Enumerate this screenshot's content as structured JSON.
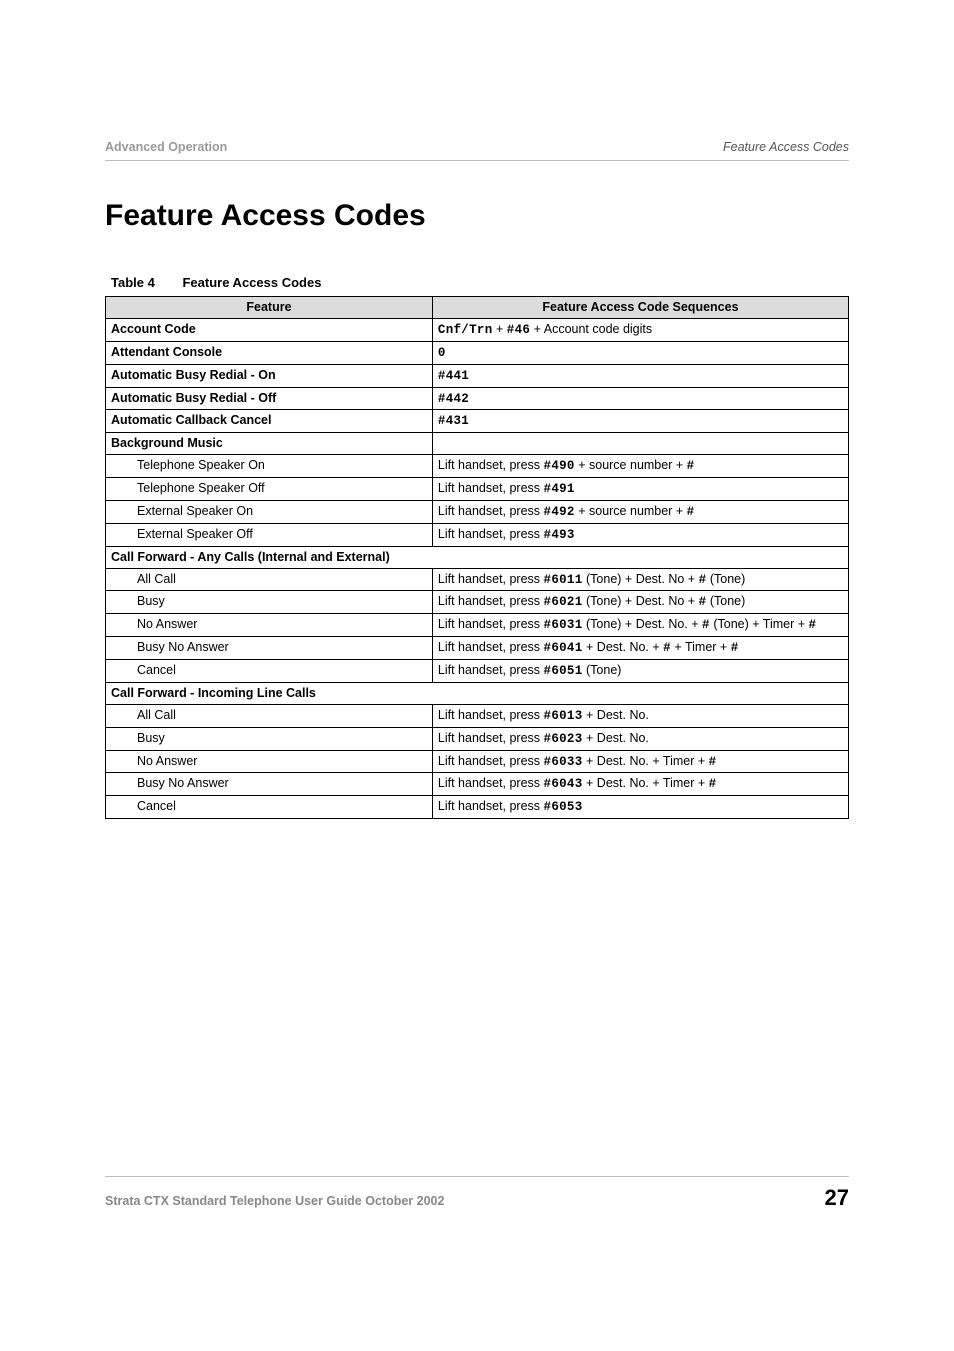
{
  "header": {
    "left": "Advanced Operation",
    "right": "Feature Access Codes"
  },
  "title": "Feature Access Codes",
  "table": {
    "number": "Table 4",
    "caption": "Feature Access Codes",
    "head_feature": "Feature",
    "head_seq": "Feature Access Code Sequences"
  },
  "rows": {
    "account_code_label": "Account Code",
    "account_code_seq_pre": "Cnf/Trn",
    "account_code_seq_plus1": " + ",
    "account_code_seq_code": "#46",
    "account_code_seq_rest": " + Account code digits",
    "attendant_label": "Attendant Console",
    "attendant_seq": "0",
    "abr_on_label": "Automatic Busy Redial - On",
    "abr_on_seq": "#441",
    "abr_off_label": "Automatic Busy Redial - Off",
    "abr_off_seq": "#442",
    "acc_label": "Automatic Callback Cancel",
    "acc_seq": "#431",
    "bg_music_label": "Background Music",
    "tel_spk_on_label": "Telephone Speaker On",
    "tel_spk_on_pre": "Lift handset, press ",
    "tel_spk_on_code": "#490",
    "tel_spk_on_mid": " + source number + ",
    "tel_spk_on_end": "#",
    "tel_spk_off_label": "Telephone Speaker Off",
    "tel_spk_off_pre": "Lift handset, press ",
    "tel_spk_off_code": "#491",
    "ext_spk_on_label": "External Speaker On",
    "ext_spk_on_pre": "Lift handset, press ",
    "ext_spk_on_code": "#492",
    "ext_spk_on_mid": " + source number + ",
    "ext_spk_on_end": "#",
    "ext_spk_off_label": "External Speaker Off",
    "ext_spk_off_pre": "Lift handset, press ",
    "ext_spk_off_code": "#493",
    "cf_any_label": "Call Forward - Any Calls (Internal and External)",
    "cf_any_all_label": "All Call",
    "cf_any_all_pre": "Lift handset, press ",
    "cf_any_all_code": "#6011",
    "cf_any_all_mid": " (Tone) + Dest. No + ",
    "cf_any_all_end": "#",
    "cf_any_all_tail": " (Tone)",
    "cf_any_busy_label": "Busy",
    "cf_any_busy_pre": "Lift handset, press ",
    "cf_any_busy_code": "#6021",
    "cf_any_busy_mid": " (Tone) + Dest. No + ",
    "cf_any_busy_end": "#",
    "cf_any_busy_tail": " (Tone)",
    "cf_any_na_label": "No Answer",
    "cf_any_na_pre": "Lift handset, press ",
    "cf_any_na_code": "#6031",
    "cf_any_na_mid": " (Tone) + Dest. No. + ",
    "cf_any_na_end": "#",
    "cf_any_na_mid2": " (Tone) + Timer + ",
    "cf_any_na_end2": "#",
    "cf_any_bna_label": "Busy No Answer",
    "cf_any_bna_pre": "Lift handset, press ",
    "cf_any_bna_code": "#6041",
    "cf_any_bna_mid": " + Dest. No. + ",
    "cf_any_bna_end": "#",
    "cf_any_bna_mid2": " + Timer + ",
    "cf_any_bna_end2": "#",
    "cf_any_cancel_label": "Cancel",
    "cf_any_cancel_pre": "Lift handset, press ",
    "cf_any_cancel_code": "#6051",
    "cf_any_cancel_tail": " (Tone)",
    "cf_inc_label": "Call Forward - Incoming Line Calls",
    "cf_inc_all_label": "All Call",
    "cf_inc_all_pre": "Lift handset, press ",
    "cf_inc_all_code": "#6013",
    "cf_inc_all_tail": " + Dest. No.",
    "cf_inc_busy_label": "Busy",
    "cf_inc_busy_pre": "Lift handset, press ",
    "cf_inc_busy_code": "#6023",
    "cf_inc_busy_tail": " + Dest. No.",
    "cf_inc_na_label": "No Answer",
    "cf_inc_na_pre": "Lift handset, press ",
    "cf_inc_na_code": "#6033",
    "cf_inc_na_mid": " + Dest. No. + Timer + ",
    "cf_inc_na_end": "#",
    "cf_inc_bna_label": "Busy No Answer",
    "cf_inc_bna_pre": "Lift handset, press ",
    "cf_inc_bna_code": "#6043",
    "cf_inc_bna_mid": " + Dest. No. + Timer + ",
    "cf_inc_bna_end": "#",
    "cf_inc_cancel_label": "Cancel",
    "cf_inc_cancel_pre": "Lift handset, press ",
    "cf_inc_cancel_code": "#6053"
  },
  "footer": {
    "text": "Strata CTX Standard Telephone User Guide  October 2002",
    "page": "27"
  }
}
